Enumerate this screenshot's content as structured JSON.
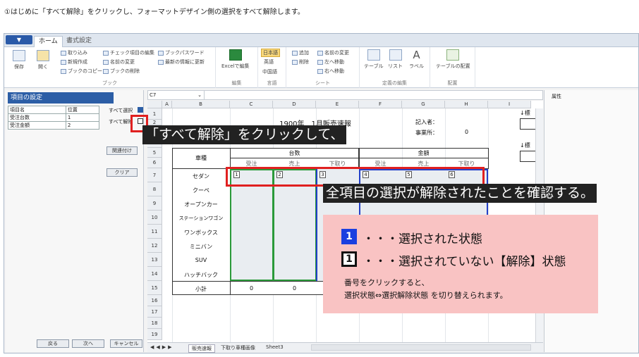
{
  "instruction": "①はじめに「すべて解除」をクリックし、フォーマットデザイン側の選択をすべて解除します。",
  "tabs": {
    "file": "▼",
    "home": "ホーム",
    "format": "書式設定"
  },
  "ribbon": {
    "save": "保存",
    "open": "開く",
    "import": "取り込み",
    "new": "新規作成",
    "copy_book": "ブックのコピー",
    "check_edit": "チェック項目の編集",
    "rename": "名前の変更",
    "delete_book": "ブックの削除",
    "book_pw": "ブックパスワード",
    "refresh": "最新の情報に更新",
    "group_book": "ブック",
    "excel_edit": "Excelで編集",
    "group_edit": "編集",
    "lang_ja": "日本語",
    "lang_en": "英語",
    "lang_zh": "中国語",
    "group_lang": "言語",
    "add": "追加",
    "del": "削除",
    "sheet_rename": "名前の変更",
    "move_left": "左へ移動",
    "move_right": "右へ移動",
    "group_sheet": "シート",
    "table": "テーブル",
    "list": "リスト",
    "label": "ラベル",
    "group_def": "定義の編集",
    "table_layout": "テーブルの配置",
    "group_layout": "配置"
  },
  "left_panel": {
    "title": "項目の設定",
    "headers": [
      "項目名",
      "位置"
    ],
    "rows": [
      [
        "受注台数",
        "1"
      ],
      [
        "受注金額",
        "2"
      ]
    ],
    "select_all": "すべて選択",
    "clear_all": "すべて解除",
    "link": "関連付け",
    "clear": "クリア",
    "back": "戻る",
    "next": "次へ",
    "cancel": "キャンセル"
  },
  "formula": {
    "cellref": "C7",
    "dropdown": "⌄"
  },
  "sheet": {
    "columns": [
      "A",
      "B",
      "C",
      "D",
      "E",
      "F",
      "G",
      "H",
      "I"
    ],
    "rows": [
      "1",
      "2",
      "3",
      "4",
      "5",
      "6",
      "7",
      "8",
      "9",
      "10",
      "11",
      "12",
      "13",
      "14",
      "15",
      "16",
      "17",
      "18",
      "19"
    ],
    "title": "1900年　1月販売速報",
    "recorder": "記入者：",
    "office": "事業所：",
    "office_val": "0",
    "car_type": "車種",
    "units": "台数",
    "amount": "金額",
    "sub_headers": [
      "受注",
      "売上",
      "下取り",
      "受注",
      "売上",
      "下取り"
    ],
    "cars": [
      "セダン",
      "クーペ",
      "オープンカー",
      "ステーションワゴン",
      "ワンボックス",
      "ミニバン",
      "SUV",
      "ハッチバック",
      "小計"
    ],
    "subtotal": [
      "0",
      "0"
    ],
    "boxes": [
      "1",
      "2",
      "3",
      "4",
      "5",
      "6"
    ],
    "right_mark": "↓標"
  },
  "sheet_tabs": [
    "販売速報",
    "下取り車種画像",
    "Sheet3"
  ],
  "right_panel": {
    "title": "属性"
  },
  "callouts": {
    "c1": "「すべて解除」をクリックして、",
    "c2": "全項目の選択が解除されたことを確認する。",
    "selected": "・・・選択された状態",
    "unselected": "・・・選択されていない【解除】状態",
    "num": "1",
    "note1": "番号をクリックすると、",
    "note2": "選択状態⇔選択解除状態 を切り替えられます。"
  }
}
